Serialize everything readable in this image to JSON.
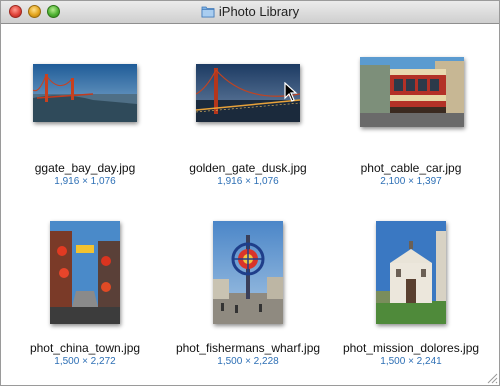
{
  "window": {
    "title": "iPhoto Library"
  },
  "files": [
    {
      "name": "ggate_bay_day.jpg",
      "dims": "1,916 × 1,076"
    },
    {
      "name": "golden_gate_dusk.jpg",
      "dims": "1,916 × 1,076"
    },
    {
      "name": "phot_cable_car.jpg",
      "dims": "2,100 × 1,397"
    },
    {
      "name": "phot_china_town.jpg",
      "dims": "1,500 × 2,272"
    },
    {
      "name": "phot_fishermans_wharf.jpg",
      "dims": "1,500 × 2,228"
    },
    {
      "name": "phot_mission_dolores.jpg",
      "dims": "1,500 × 2,241"
    }
  ],
  "colors": {
    "dims_text": "#2d6fb5",
    "selection": "none"
  }
}
